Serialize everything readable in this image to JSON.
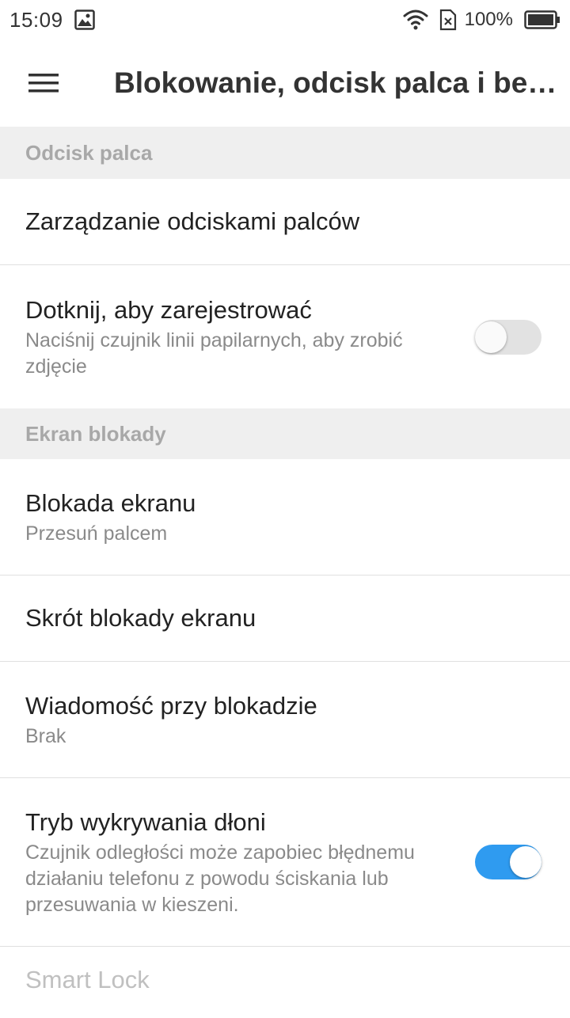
{
  "status_bar": {
    "time": "15:09",
    "battery_percent": "100%",
    "icons": [
      "image-icon",
      "wifi-icon",
      "no-sim-icon",
      "battery-icon"
    ]
  },
  "app_bar": {
    "title": "Blokowanie, odcisk palca i be…"
  },
  "sections": {
    "fingerprint": {
      "header": "Odcisk palca",
      "manage": {
        "title": "Zarządzanie odciskami palców"
      },
      "tap_to_register": {
        "title": "Dotknij, aby zarejestrować",
        "subtitle": "Naciśnij czujnik linii papilarnych, aby zrobić zdjęcie",
        "enabled": false
      }
    },
    "lock_screen": {
      "header": "Ekran blokady",
      "screen_lock": {
        "title": "Blokada ekranu",
        "subtitle": "Przesuń palcem"
      },
      "lock_shortcut": {
        "title": "Skrót blokady ekranu"
      },
      "lock_message": {
        "title": "Wiadomość przy blokadzie",
        "subtitle": "Brak"
      },
      "palm_detection": {
        "title": "Tryb wykrywania dłoni",
        "subtitle": "Czujnik odległości może zapobiec błędnemu działaniu telefonu z powodu ściskania lub przesuwania w kieszeni.",
        "enabled": true
      },
      "smart_lock": {
        "title": "Smart Lock"
      }
    }
  },
  "colors": {
    "accent": "#2f9bf0",
    "section_bg": "#efefef",
    "section_text": "#a8a8a8",
    "divider": "#e0e0e0"
  }
}
